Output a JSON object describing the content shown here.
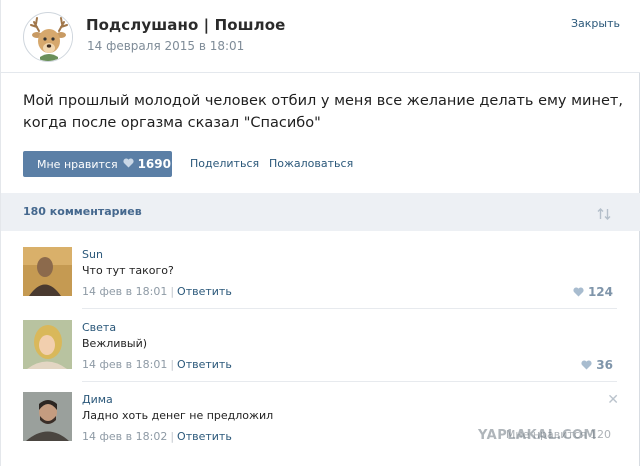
{
  "post": {
    "group_name": "Подслушано | Пошлое",
    "date": "14 февраля 2015 в 18:01",
    "close_label": "Закрыть",
    "text_line1": "Мой прошлый молодой человек отбил у меня все желание делать ему минет,",
    "text_line2": "когда после оргазма сказал \"Спасибо\"",
    "like_label": "Мне нравится",
    "like_count": "1690",
    "share_label": "Поделиться",
    "report_label": "Пожаловаться"
  },
  "comments_header": {
    "count_label": "180 комментариев",
    "sort_icon": "sort-arrows-icon"
  },
  "comments": [
    {
      "author": "Sun",
      "text": "Что тут такого?",
      "date": "14 фев в 18:01",
      "reply": "Ответить",
      "likes": "124"
    },
    {
      "author": "Света",
      "text": "Вежливый)",
      "date": "14 фев в 18:01",
      "reply": "Ответить",
      "likes": "36"
    },
    {
      "author": "Дима",
      "text": "Ладно хоть денег не предложил",
      "date": "14 фев в 18:02",
      "reply": "Ответить",
      "likes": "120"
    }
  ],
  "watermark": {
    "text": "YAPLAKAL.COM",
    "overlay_like_text": "Мне нравится"
  },
  "colors": {
    "accent": "#5b7fa6",
    "link": "#2b587a",
    "muted": "#8e9aa5",
    "bar": "#edf0f4"
  }
}
